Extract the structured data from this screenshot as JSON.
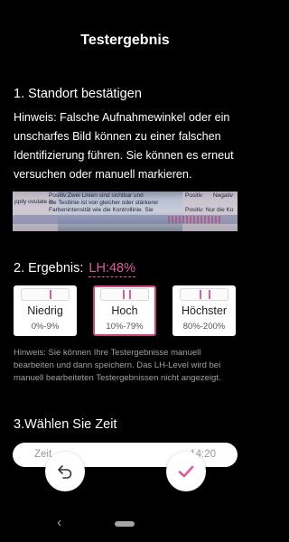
{
  "header": {
    "title": "Testergebnis"
  },
  "step1": {
    "heading": "1. Standort bestätigen",
    "hint": "Hinweis: Falsche Aufnahmewinkel oder ein unscharfes Bild können zu einer falschen Identifizierung führen. Sie können es erneut versuchen oder manuell markieren."
  },
  "strip": {
    "lines": [
      "Positiv:Zwei Linien sind sichtbar und",
      "die Testlinie ist von gleicher oder stärkerer",
      "Farbenintensität wie die Kontrollinie. Sie"
    ],
    "left_text": "ppily ovulate in",
    "right_label_1": "Positiv",
    "right_label_2": "Negativ",
    "right_label_3": "Positiv: Nur die Ko"
  },
  "step2": {
    "heading": "2. Ergebnis:",
    "lh_value": "LH:48%",
    "options": [
      {
        "level": "Niedrig",
        "range": "0%-9%",
        "selected": false
      },
      {
        "level": "Hoch",
        "range": "10%-79%",
        "selected": true
      },
      {
        "level": "Höchster",
        "range": "80%-200%",
        "selected": false
      }
    ],
    "hint": "Hinweis: Sie können Ihre Testergebnisse manuell bearbeiten und dann speichern. Das LH-Level wird bei manuell bearbeiteten Testergebnissen nicht angezeigt."
  },
  "step3": {
    "heading": "3.Wählen Sie Zeit",
    "time_left": "Zeit",
    "time_right": "14:20"
  },
  "actions": {
    "undo_icon": "undo-icon",
    "confirm_icon": "checkmark-icon"
  },
  "navbar": {
    "back_glyph": "‹"
  },
  "colors": {
    "accent": "#e05a9d",
    "card_border": "#c9437f",
    "background": "#000000"
  }
}
